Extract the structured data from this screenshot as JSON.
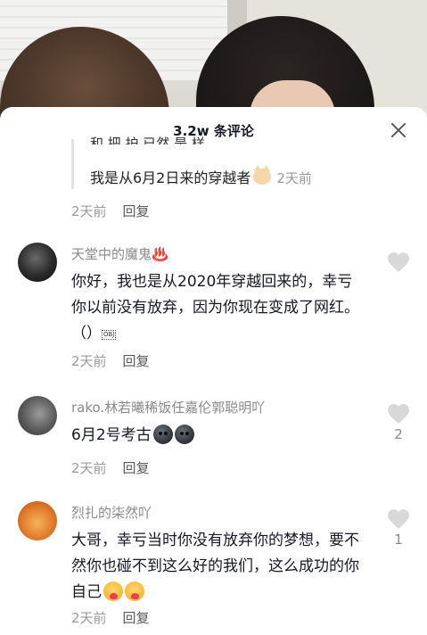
{
  "sheet": {
    "title": "3.2w 条评论",
    "close_label": "×"
  },
  "reply": {
    "cut_text": "和 把 护 已然 是 样",
    "text": "我是从6月2日来的穿越者",
    "time": "2天前"
  },
  "first_meta": {
    "time": "2天前",
    "reply_label": "回复"
  },
  "comments": [
    {
      "name": "天堂中的魔鬼♨️",
      "text": "你好，我也是从2020年穿越回来的，幸亏你以前没有放弃，因为你现在变成了网红。（）",
      "obj": "OBJ",
      "time": "2天前",
      "reply_label": "回复",
      "likes": ""
    },
    {
      "name": "rako.林若曦稀饭任嘉伦郭聪明吖",
      "text": "6月2号考古",
      "time": "2天前",
      "reply_label": "回复",
      "likes": "2"
    },
    {
      "name": "烈扎的柒然吖",
      "text": "大哥，幸亏当时你没有放弃你的梦想，要不然你也碰不到这么好的我们，这么成功的你自己",
      "time": "2天前",
      "reply_label": "回复",
      "likes": "1"
    }
  ],
  "colors": {
    "text_primary": "#161823",
    "text_secondary": "#8a8a8a",
    "heart": "#d8d8d8"
  }
}
